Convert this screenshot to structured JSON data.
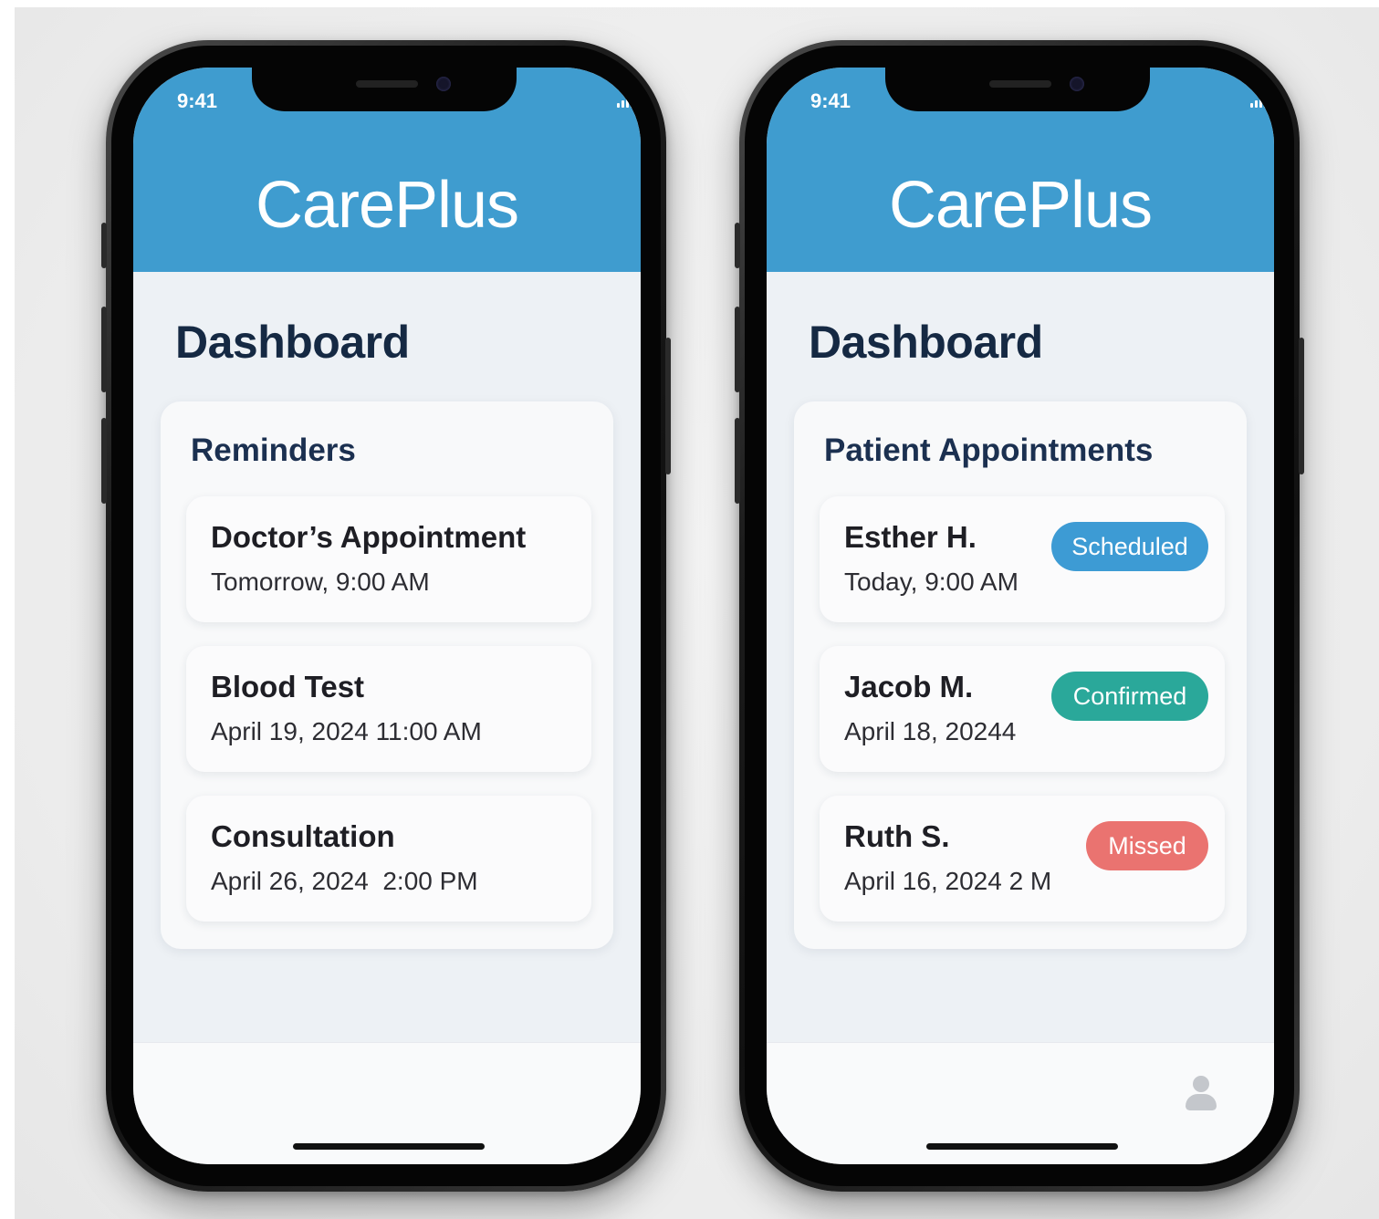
{
  "phones": {
    "left": {
      "status_time": "9:41",
      "app_title": "CarePlus",
      "page_title": "Dashboard",
      "panel_title": "Reminders",
      "items": [
        {
          "title": "Doctor’s Appointment",
          "subtitle": "Tomorrow, 9:00 AM"
        },
        {
          "title": "Blood Test",
          "subtitle": "April 19, 2024 11:00 AM"
        },
        {
          "title": "Consultation",
          "subtitle": "April 26, 2024  2:00 PM"
        }
      ]
    },
    "right": {
      "status_time": "9:41",
      "app_title": "CarePlus",
      "page_title": "Dashboard",
      "panel_title": "Patient Appointments",
      "items": [
        {
          "title": "Esther H.",
          "subtitle": "Today, 9:00 AM",
          "status": "Scheduled",
          "status_color": "#3d9bd4"
        },
        {
          "title": "Jacob M.",
          "subtitle": "April 18, 20244",
          "status": "Confirmed",
          "status_color": "#2aa89a"
        },
        {
          "title": "Ruth S.",
          "subtitle": "April 16, 2024 2 M",
          "status": "Missed",
          "status_color": "#ea7370"
        }
      ]
    }
  },
  "colors": {
    "header": "#3f9ccf",
    "title_dark": "#152943",
    "screen_bg": "#edf1f5"
  },
  "icons": {
    "status_bar": [
      "signal-icon",
      "wifi-icon",
      "battery-icon"
    ],
    "tab_bar": "profile-icon"
  }
}
